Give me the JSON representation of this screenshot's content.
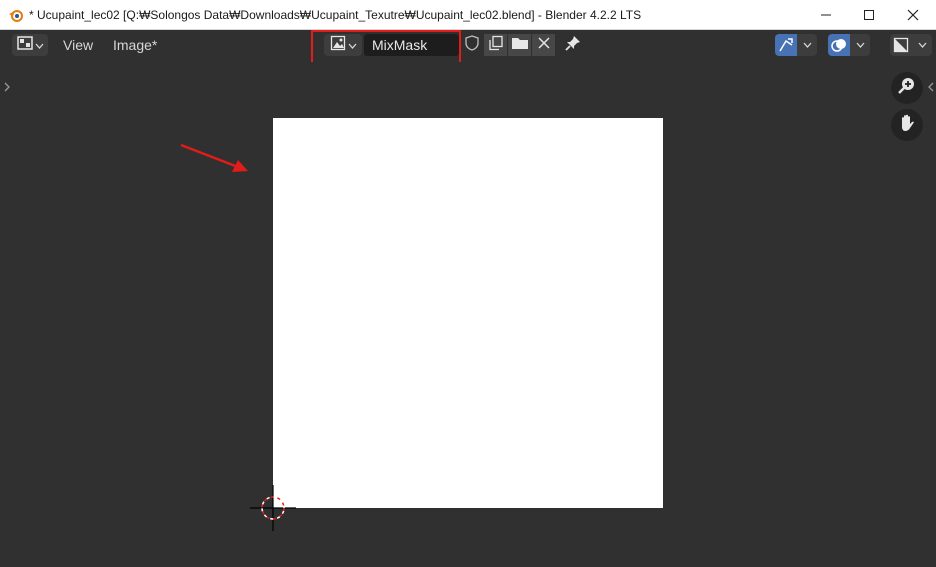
{
  "window": {
    "title": "* Ucupaint_lec02 [Q:₩Solongos Data₩Downloads₩Ucupaint_Texutre₩Ucupaint_lec02.blend] - Blender 4.2.2 LTS",
    "app_icon": "blender-icon",
    "controls": [
      "minimize-icon",
      "maximize-icon",
      "close-icon"
    ]
  },
  "header": {
    "editor_type_icon": "image-editor-icon",
    "menus": [
      "View",
      "Image*"
    ],
    "image_browse_icon": "image-browse-icon",
    "image_name": "MixMask",
    "image_tools": [
      "fake-user-shield-icon",
      "duplicate-image-icon",
      "open-folder-icon",
      "unlink-x-icon"
    ],
    "pin_icon": "pin-icon",
    "right_controls": [
      "uv-sync-icon",
      "overlay-icon",
      "display-channels-icon"
    ]
  },
  "viewport": {
    "navigation": [
      "zoom-icon",
      "hand-pan-icon"
    ],
    "image_fill": "#ffffff",
    "accent_colors": {
      "highlight": "#e21b1b",
      "active_button": "#4772b3"
    }
  }
}
